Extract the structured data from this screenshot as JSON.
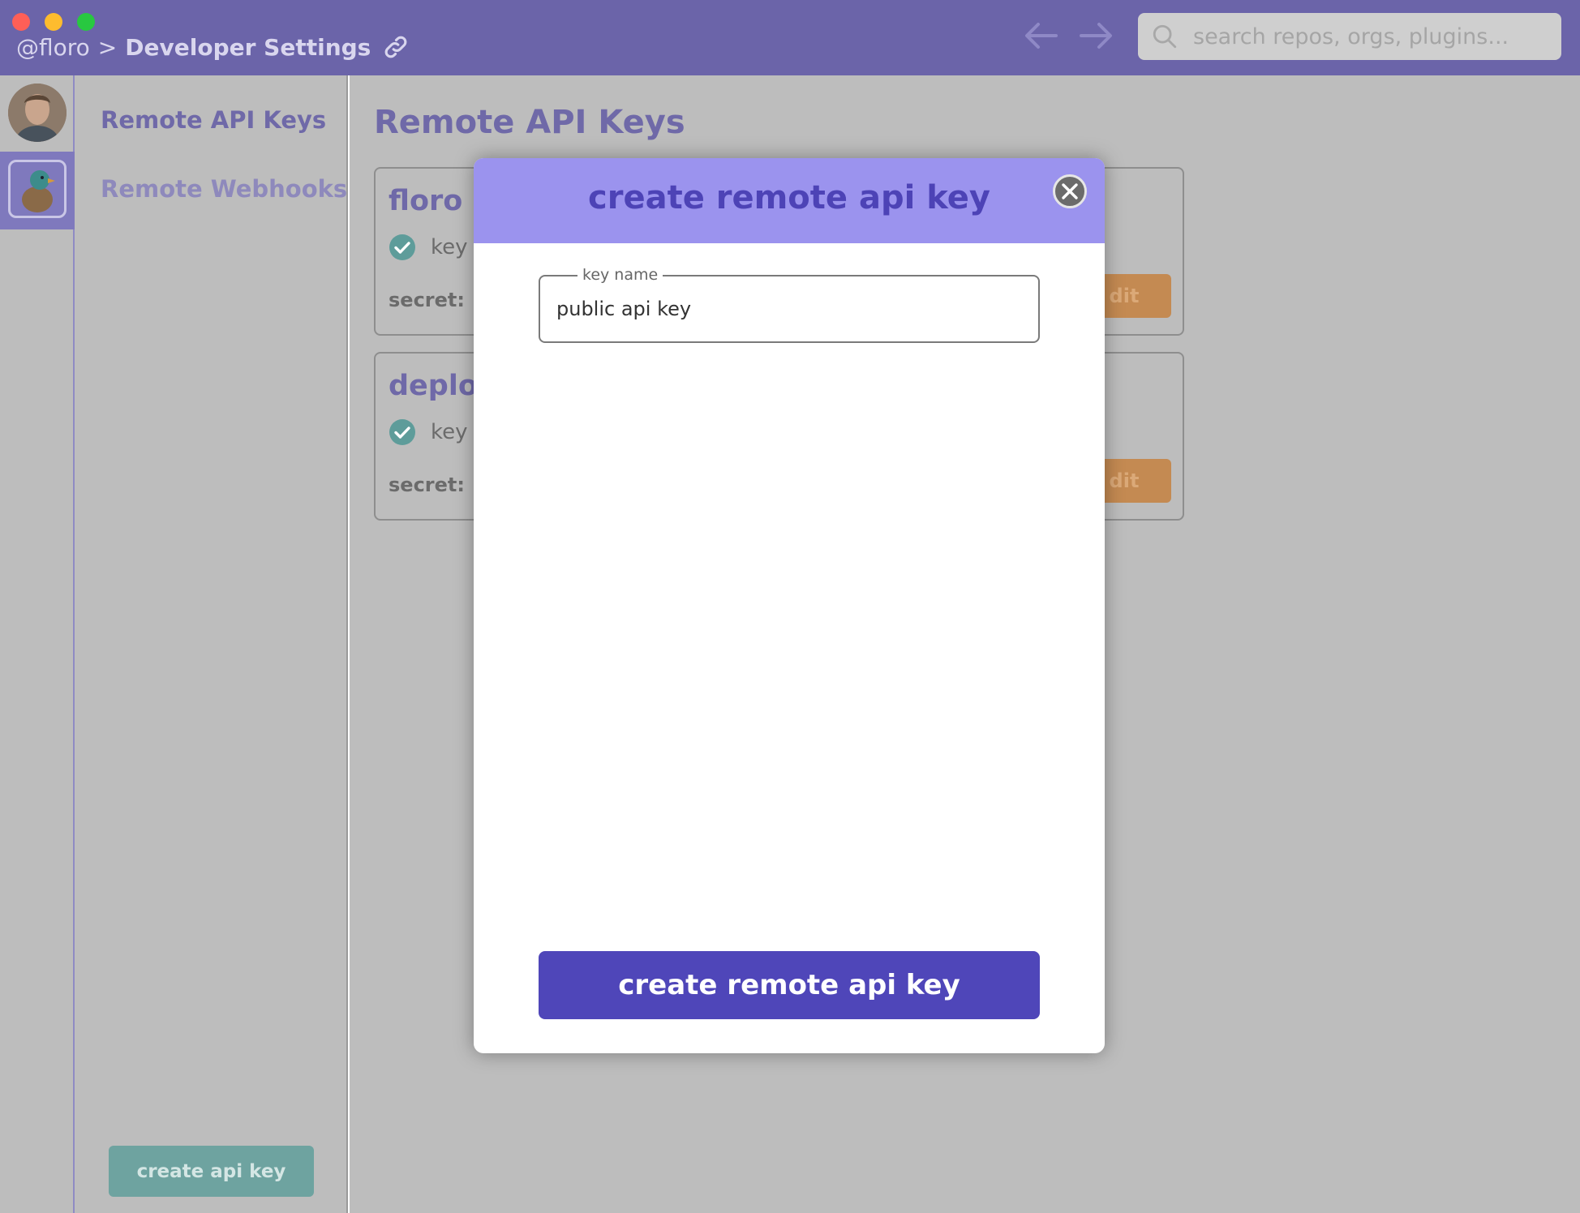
{
  "titlebar": {
    "user": "@floro",
    "separator": ">",
    "section": "Developer Settings",
    "search_placeholder": "search repos, orgs, plugins..."
  },
  "sidebar": {
    "items": [
      {
        "label": "Remote API Keys"
      },
      {
        "label": "Remote Webhooks"
      }
    ],
    "create_button": "create api key"
  },
  "main": {
    "title": "Remote API Keys",
    "keys": [
      {
        "name": "floro m",
        "key_label": "key",
        "secret_label": "secret:",
        "edit_label": "dit"
      },
      {
        "name": "deploy",
        "key_label": "key",
        "secret_label": "secret:",
        "edit_label": "dit"
      }
    ]
  },
  "modal": {
    "title": "create remote api key",
    "field_label": "key name",
    "field_value": "public api key",
    "submit_label": "create remote api key"
  },
  "colors": {
    "titlebar": "#6b64a9",
    "accent": "#4f46b9",
    "modal_header": "#9b93ee",
    "teal": "#6ea3a0",
    "orange": "#c48a52"
  }
}
